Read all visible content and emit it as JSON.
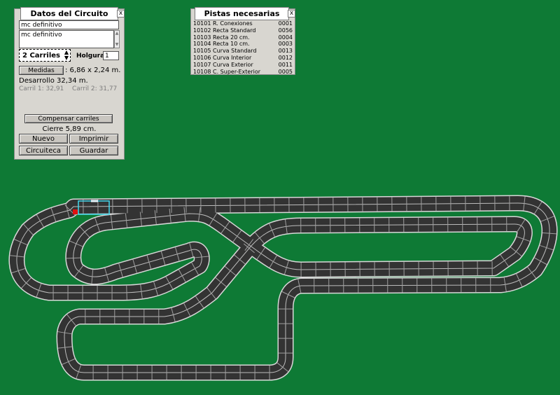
{
  "circuit_panel": {
    "title": "Datos del Circuito",
    "name": "mc definitivo",
    "description": "mc definitivo",
    "lanes": "2 Carriles",
    "slack_label": "Holgura",
    "slack_value": "1",
    "measures_button": "Medidas",
    "measures_value": ": 6,86 x 2,24 m.",
    "development": "Desarrollo 32,34 m.",
    "lane1": "Carril 1: 32,91",
    "lane2": "Carril 2: 31,77",
    "compensate_button": "Compensar carriles",
    "closure": "Cierre 5,89 cm.",
    "new_button": "Nuevo",
    "print_button": "Imprimir",
    "library_button": "Circuiteca",
    "save_button": "Guardar",
    "close_glyph": "x"
  },
  "pistas_panel": {
    "title": "Pistas necesarias",
    "close_glyph": "x",
    "pieces": [
      {
        "code": "10101",
        "name": "R. Conexiones",
        "qty": "0001"
      },
      {
        "code": "10102",
        "name": "Recta Standard",
        "qty": "0056"
      },
      {
        "code": "10103",
        "name": "Recta 20 cm.",
        "qty": "0004"
      },
      {
        "code": "10104",
        "name": "Recta 10 cm.",
        "qty": "0003"
      },
      {
        "code": "10105",
        "name": "Curva Standard",
        "qty": "0013"
      },
      {
        "code": "10106",
        "name": "Curva Interior",
        "qty": "0012"
      },
      {
        "code": "10107",
        "name": "Curva Exterior",
        "qty": "0011"
      },
      {
        "code": "10108",
        "name": "C. Super-Exterior",
        "qty": "0005"
      }
    ]
  },
  "colors": {
    "background": "#0e7a35",
    "track": "#333333",
    "track_edge": "#d8d8d8",
    "selection": "#44d8ee",
    "start_marker": "#e01010"
  }
}
